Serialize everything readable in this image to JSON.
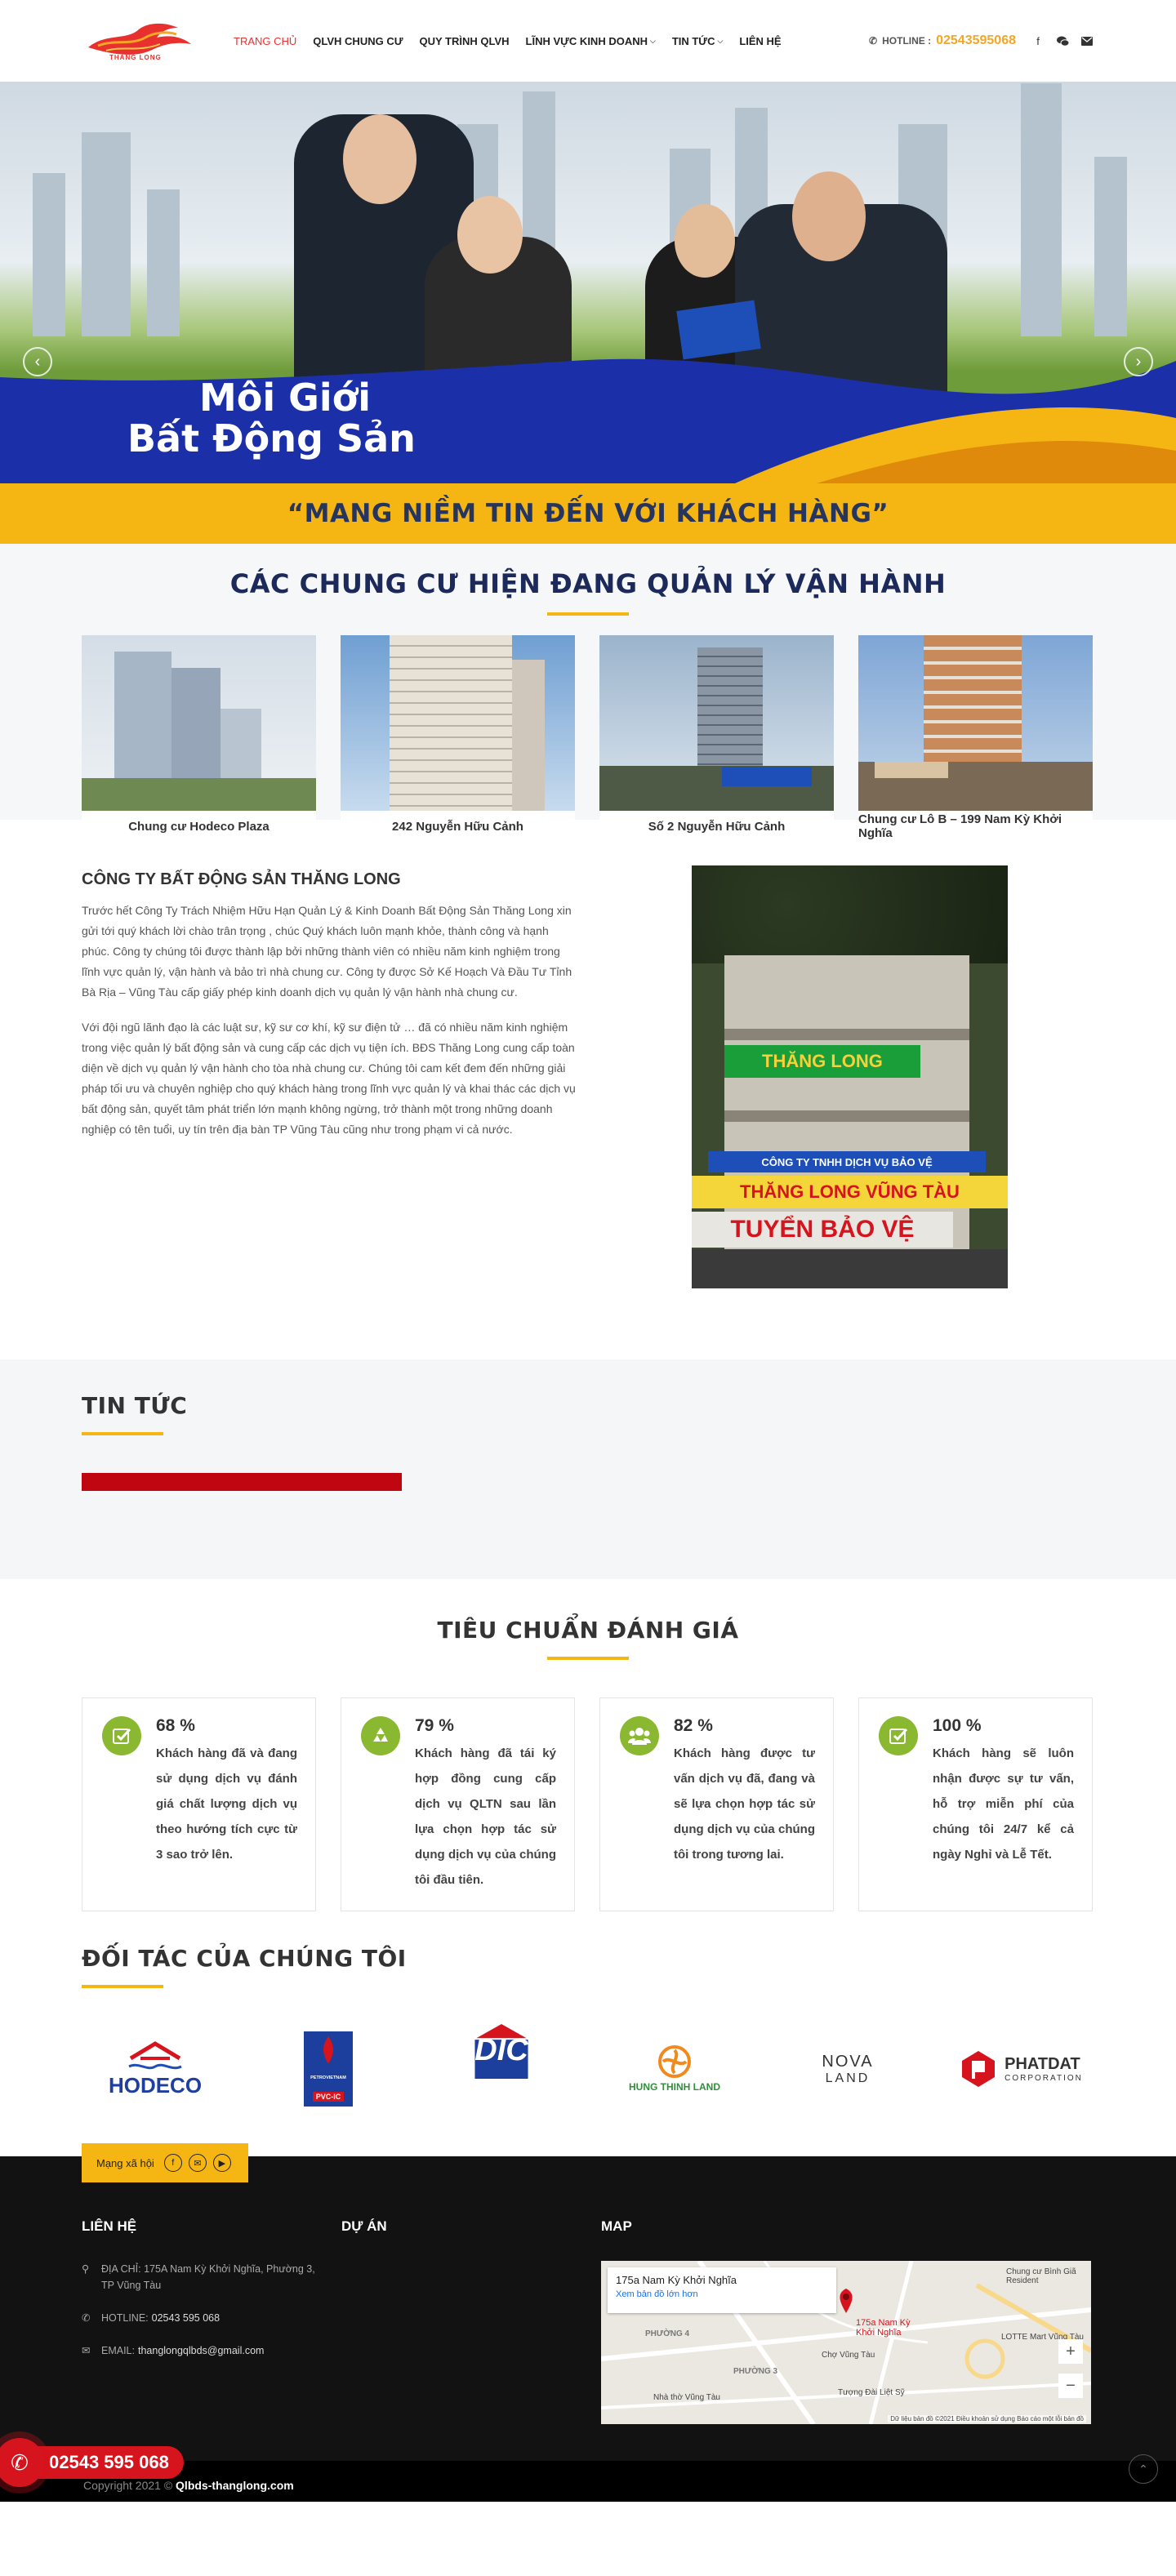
{
  "header": {
    "logo_text": "THĂNG LONG",
    "nav": [
      {
        "label": "TRANG CHỦ",
        "has_dropdown": false
      },
      {
        "label": "QLVH CHUNG CƯ",
        "has_dropdown": false
      },
      {
        "label": "QUY TRÌNH QLVH",
        "has_dropdown": false
      },
      {
        "label": "LĨNH VỰC KINH DOANH",
        "has_dropdown": true
      },
      {
        "label": "TIN TỨC",
        "has_dropdown": true
      },
      {
        "label": "LIÊN HỆ",
        "has_dropdown": false
      }
    ],
    "hotline_label": "HOTLINE :",
    "hotline_number": "02543595068",
    "social_icons": [
      "facebook-icon",
      "wechat-icon",
      "email-icon"
    ]
  },
  "hero": {
    "banner_line1": "Môi Giới",
    "banner_line2": "Bất Động Sản",
    "prev": "‹",
    "next": "›"
  },
  "slogan": "“MANG NIỀM TIN ĐẾN VỚI KHÁCH HÀNG”",
  "apartments": {
    "title": "CÁC CHUNG CƯ HIỆN ĐANG QUẢN LÝ VẬN HÀNH",
    "items": [
      {
        "caption": "Chung cư Hodeco Plaza"
      },
      {
        "caption": "242 Nguyễn Hữu Cảnh"
      },
      {
        "caption": "Số 2 Nguyễn Hữu Cảnh"
      },
      {
        "caption": "Chung cư Lô B – 199 Nam Kỳ Khởi Nghĩa"
      }
    ]
  },
  "about": {
    "title": "CÔNG TY BẤT ĐỘNG SẢN THĂNG LONG",
    "p1": "Trước hết Công Ty Trách Nhiệm Hữu Hạn Quản Lý & Kinh Doanh Bất Động Sản Thăng Long xin gửi tới quý khách lời chào trân trọng , chúc Quý khách luôn mạnh khỏe, thành công và hạnh phúc. Công ty chúng tôi được thành lập bởi những thành viên có nhiều năm kinh nghiệm trong lĩnh vực quản lý, vận hành và bảo trì nhà chung cư. Công ty được Sở Kế Hoạch Và Đầu Tư Tỉnh Bà Rịa – Vũng Tàu cấp giấy phép kinh doanh dịch vụ quản lý vận hành nhà chung cư.",
    "p2": "Với đội ngũ lãnh đạo là các luật sư, kỹ sư cơ khí, kỹ sư điện tử … đã có nhiều năm kinh nghiệm trong việc quản lý bất động sản và cung cấp các dịch vụ tiện ích. BĐS Thăng Long cung cấp toàn diện về dịch vụ quản lý vận hành cho tòa nhà chung cư. Chúng tôi cam kết đem đến những giải pháp tối ưu và chuyên nghiệp cho quý khách hàng trong lĩnh vực quản lý và khai thác các dịch vụ bất động sản, quyết tâm phát triển lớn mạnh không ngừng, trở thành một trong những doanh nghiệp có tên tuổi, uy tín trên địa bàn TP Vũng Tàu cũng như trong phạm vi cả nước.",
    "sign_line1": "THĂNG LONG",
    "sign_line2": "CÔNG TY TNHH DỊCH VỤ BẢO VỆ",
    "sign_line3": "THĂNG LONG VŨNG TÀU",
    "sign_line4": "TUYỂN BẢO VỆ"
  },
  "news": {
    "title": "TIN TỨC"
  },
  "criteria": {
    "title": "TIÊU CHUẨN ĐÁNH GIÁ",
    "items": [
      {
        "icon": "check-badge-icon",
        "percent": "68 %",
        "desc": "Khách hàng đã và đang sử dụng dịch vụ đánh giá chất lượng dịch vụ theo hướng tích cực từ 3 sao trở lên."
      },
      {
        "icon": "recycle-icon",
        "percent": "79 %",
        "desc": "Khách hàng đã tái ký hợp đồng cung cấp dịch vụ QLTN sau lần lựa chọn hợp tác sử dụng dịch vụ của chúng tôi đầu tiên."
      },
      {
        "icon": "users-icon",
        "percent": "82 %",
        "desc": "Khách hàng được tư vấn dịch vụ đã, đang và sẽ lựa chọn hợp tác sử dụng dịch vụ của chúng tôi trong tương lai."
      },
      {
        "icon": "check-badge-icon",
        "percent": "100 %",
        "desc": "Khách hàng sẽ luôn nhận được sự tư vấn, hỗ trợ miễn phí của chúng tôi 24/7 kể cả ngày Nghỉ và Lễ Tết."
      }
    ],
    "accent": "#8ab830"
  },
  "partners": {
    "title": "ĐỐI TÁC CỦA CHÚNG TÔI",
    "items": [
      {
        "name": "HODECO"
      },
      {
        "name": "PETROVIETNAM",
        "sub": "PVC-IC"
      },
      {
        "name": "DIC"
      },
      {
        "name": "HUNG THINH LAND"
      },
      {
        "name": "NOVA",
        "sub": "LAND"
      },
      {
        "name": "PHATDAT",
        "sub": "CORPORATION"
      }
    ]
  },
  "footer": {
    "social_label": "Mạng xã hội",
    "contact_title": "LIÊN HỆ",
    "address": "ĐỊA CHỈ: 175A Nam Kỳ Khởi Nghĩa, Phường 3, TP Vũng Tàu",
    "hotline_label": "HOTLINE:",
    "hotline": "02543 595 068",
    "email_label": "EMAIL:",
    "email": "thanglongqlbds@gmail.com",
    "projects_title": "DỰ ÁN",
    "map_title": "MAP",
    "map_card_title": "175a Nam Kỳ Khởi Nghĩa",
    "map_card_link": "Xem bản đồ lớn hơn",
    "map_labels": [
      "PHƯỜNG 4",
      "PHƯỜNG 3",
      "Chợ Vũng Tàu",
      "Tượng Đài Liệt Sỹ",
      "Nhà thờ Vũng Tàu",
      "LOTTE Mart Vũng Tàu",
      "Chung cư Bình Giã Resident",
      "175a Nam Kỳ Khởi Nghĩa"
    ],
    "map_footer": "Dữ liệu bản đồ ©2021   Điều khoản sử dụng   Báo cáo một lỗi bản đồ",
    "copyright_prefix": "Copyright 2021 ©",
    "copyright_site": "Qlbds-thanglong.com",
    "floating_phone": "02543 595 068"
  }
}
